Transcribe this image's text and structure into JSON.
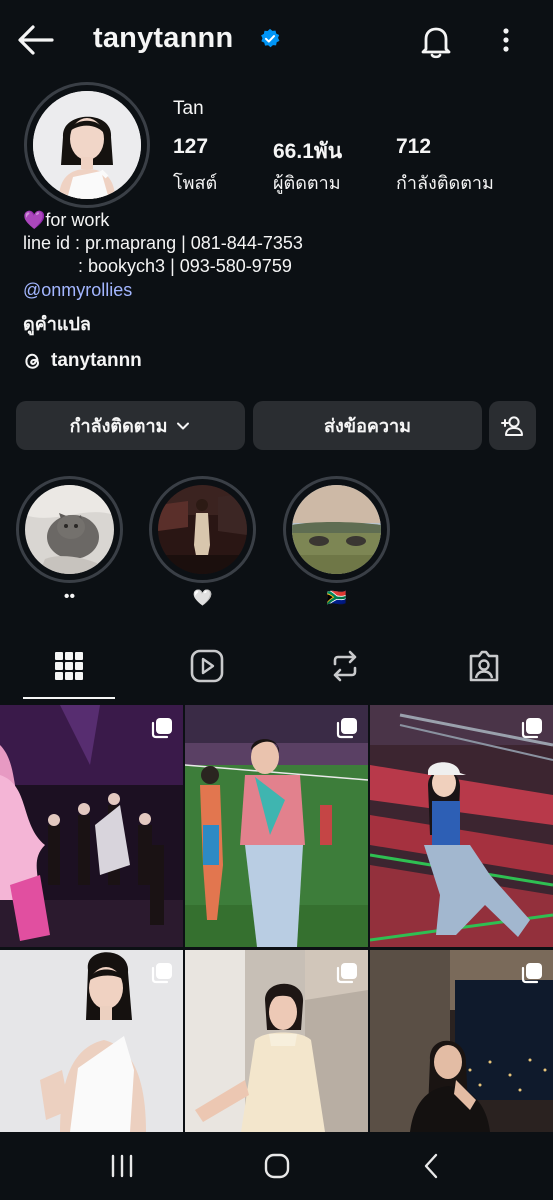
{
  "header": {
    "username": "tanytannn",
    "back_icon": "arrow-left-icon",
    "verified_icon": "verified-badge-icon",
    "bell_icon": "bell-icon",
    "more_icon": "more-vertical-icon",
    "verified_color": "#0095f6"
  },
  "profile": {
    "full_name": "Tan",
    "stats": [
      {
        "value": "127",
        "label": "โพสต์"
      },
      {
        "value": "66.1พัน",
        "label": "ผู้ติดตาม"
      },
      {
        "value": "712",
        "label": "กำลังติดตาม"
      }
    ],
    "bio_line1": "for work",
    "bio_line1_emoji": "💜",
    "bio_line2": "line id : pr.maprang | 081-844-7353",
    "bio_line3": "           : bookych3 | 093-580-9759",
    "bio_link": "@onmyrollies",
    "see_translation": "ดูคำแปล",
    "threads_handle": "tanytannn",
    "link_color": "#a3b6ff"
  },
  "actions": {
    "following_label": "กำลังติดตาม",
    "message_label": "ส่งข้อความ",
    "add_person_icon": "add-person-icon",
    "chevron_icon": "chevron-down-icon"
  },
  "highlights": [
    {
      "label": "••"
    },
    {
      "label": "🤍"
    },
    {
      "label": "🇿🇦"
    }
  ],
  "tabs": [
    {
      "name": "grid",
      "icon": "grid-icon",
      "active": true
    },
    {
      "name": "reels",
      "icon": "reels-icon",
      "active": false
    },
    {
      "name": "reposts",
      "icon": "repost-icon",
      "active": false
    },
    {
      "name": "tagged",
      "icon": "tagged-icon",
      "active": false
    }
  ],
  "posts": [
    {
      "type": "carousel"
    },
    {
      "type": "carousel"
    },
    {
      "type": "carousel"
    },
    {
      "type": "carousel"
    },
    {
      "type": "carousel"
    },
    {
      "type": "carousel"
    }
  ],
  "system_nav": {
    "recents_icon": "recents-icon",
    "home_icon": "home-icon",
    "back_icon": "back-chevron-icon"
  }
}
